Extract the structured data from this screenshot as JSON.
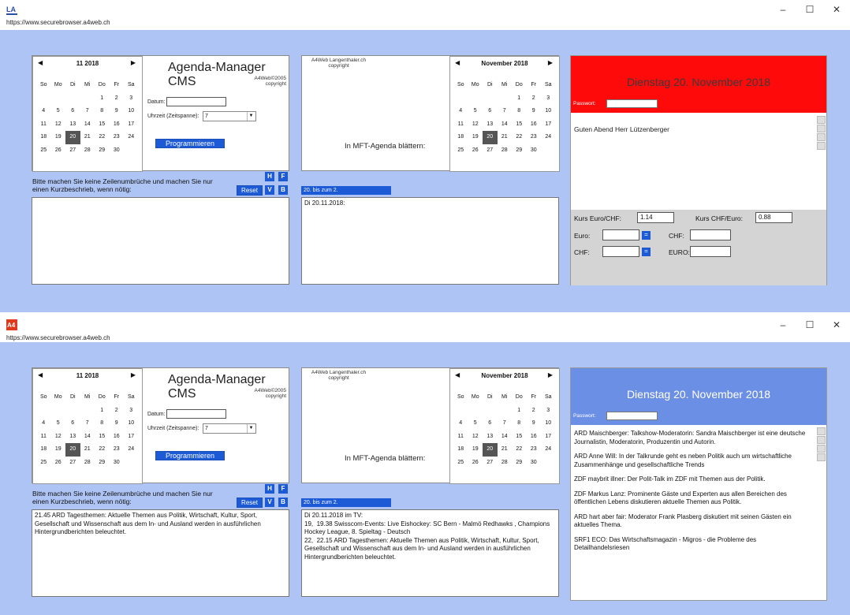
{
  "window1": {
    "url": "https://www.securebrowser.a4web.ch",
    "controls": {
      "minimize": "–",
      "maximize": "☐",
      "close": "✕"
    },
    "accent_red": "#ff0a0a"
  },
  "window2": {
    "url": "https://www.securebrowser.a4web.ch",
    "controls": {
      "minimize": "–",
      "maximize": "☐",
      "close": "✕"
    },
    "accent_blue": "#6c8fe6"
  },
  "cms": {
    "title": "Agenda-Manager CMS",
    "brand_line1": "A4Web©2005",
    "brand_line2": "copyright",
    "datum_label": "Datum:",
    "uhrzeit_label": "Uhrzeit (Zeitspanne):",
    "uhrzeit_value": "7",
    "programmieren_label": "Programmieren",
    "note": "Bitte machen Sie keine Zeilenumbrüche und machen Sie nur einen Kurzbeschrieb, wenn nötig:",
    "btn_h": "H",
    "btn_f": "F",
    "btn_reset": "Reset",
    "btn_v": "V",
    "btn_b": "B"
  },
  "calendar_small": {
    "header": "11 2018",
    "prev": "◀",
    "next": "▶",
    "dow": [
      "So",
      "Mo",
      "Di",
      "Mi",
      "Do",
      "Fr",
      "Sa"
    ],
    "days": [
      "",
      "",
      "",
      "",
      "1",
      "2",
      "3",
      "4",
      "5",
      "6",
      "7",
      "8",
      "9",
      "10",
      "11",
      "12",
      "13",
      "14",
      "15",
      "16",
      "17",
      "18",
      "19",
      "20",
      "21",
      "22",
      "23",
      "24",
      "25",
      "26",
      "27",
      "28",
      "29",
      "30",
      ""
    ],
    "selected": "20"
  },
  "calendar_mft": {
    "header": "November 2018",
    "prev": "◀",
    "next": "▶"
  },
  "mft": {
    "brand_line1": "A4Web Langenthaler.ch",
    "brand_line2": "copyright",
    "label": "In MFT-Agenda blättern:",
    "range_bar": "20. bis zum 2.",
    "text_w1": "Di 20.11.2018:",
    "text_w2": "Di 20.11.2018 im TV:\n19,  19.38 Swisscom-Events: Live Eishockey: SC Bern - Malmö Redhawks , Champions Hockey League, 8. Spieltag - Deutsch\n22,  22.15 ARD Tagesthemen: Aktuelle Themen aus Politik, Wirtschaft, Kultur, Sport, Gesellschaft und Wissenschaft aus dem In- und Ausland werden in ausführlichen Hintergrundberichten beleuchtet."
  },
  "cms_text_w2": "21.45 ARD Tagesthemen: Aktuelle Themen aus Politik, Wirtschaft, Kultur, Sport, Gesellschaft und Wissenschaft aus dem In- und Ausland werden in ausführlichen Hintergrundberichten beleuchtet.",
  "right": {
    "date_title": "Dienstag 20. November 2018",
    "password_label": "Passwort:",
    "greeting": "Guten Abend Herr Lützenberger",
    "kurs_euro_chf_label": "Kurs Euro/CHF:",
    "kurs_euro_chf_value": "1.14",
    "kurs_chf_euro_label": "Kurs CHF/Euro:",
    "kurs_chf_euro_value": "0.88",
    "euro_label": "Euro:",
    "chf_label": "CHF:",
    "chf2_label": "CHF:",
    "euro2_label": "EURO:",
    "eq": "="
  },
  "tv_list": [
    "ARD Maischberger: Talkshow-Moderatorin: Sandra Maischberger ist eine deutsche Journalistin, Moderatorin, Produzentin und Autorin.",
    "ARD Anne Will: In der Talkrunde geht es neben Politik auch um wirtschaftliche Zusammenhänge und gesellschaftliche Trends",
    "ZDF maybrit illner: Der Polit-Talk im ZDF mit Themen aus der Politik.",
    "ZDF Markus Lanz: Prominente Gäste und Experten aus allen Bereichen des öffentlichen Lebens diskutieren aktuelle Themen aus Politik.",
    "ARD hart aber fair: Moderator Frank Plasberg diskutiert mit seinen Gästen ein aktuelles Thema.",
    "SRF1 ECO: Das Wirtschaftsmagazin - Migros - die Probleme des Detailhandelsriesen"
  ]
}
